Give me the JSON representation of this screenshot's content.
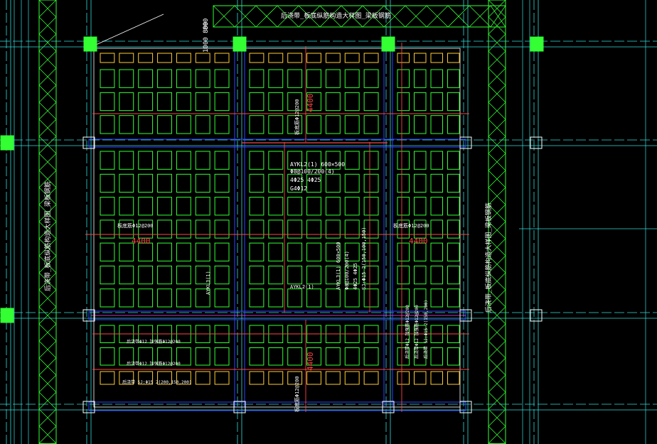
{
  "colors": {
    "background": "#000000",
    "green": "#33ff33",
    "yellow": "#ffcc33",
    "blue": "#3344ff",
    "red": "#ff4444",
    "cyan": "#33dddd",
    "white": "#ffffff",
    "magenta": "#ff44ff"
  },
  "labels": {
    "top_band": "后浇带_板底纵筋构造大样图_梁板钢筋",
    "dim_800_a": "800",
    "dim_800_b": "1000 800",
    "left_band": "后浇带_板底纵筋构造大样图_梁板钢筋",
    "right_band": "后浇带_板底纵筋构造大样图_梁板钢筋",
    "beam_note_1": "AYKL2(1) 600×500",
    "beam_note_2": "Φ8@100/200(4)",
    "beam_note_3": "4Φ25 4Φ25",
    "beam_note_4": "G4Φ12",
    "beam_note_5": "SJ:Φ15 2(150,100,150)",
    "dim_4400_top": "4400",
    "dim_4400_left": "4400",
    "dim_4400_right": "4400",
    "dim_4400_bottom": "4400",
    "slab_note_left": "板底筋Φ12@200",
    "slab_note_right": "板底筋Φ12@200",
    "slab_note_top": "板底筋Φ12@200",
    "slab_note_bottom": "板底筋Φ12@200",
    "beam_v_1": "AYKL3(1)",
    "beam_v_2": "AYKL3(1) 600×500",
    "beam_v_3": "Φ8@100/200(4)",
    "beam_v_4": "4Φ25 4Φ25",
    "beam_v_5": "SJ:Φ15 2(150,100,150)",
    "beam_mid": "AYKL2(1)",
    "note_b1": "后浇带Φ12 加强筋Φ12@200",
    "note_b2": "后浇带Φ12 加强筋Φ12@200",
    "note_b3": "后浇带 SJ:Φ15 2(200,150,200)",
    "note_r1": "后浇带Φ12 加强筋Φ12@200",
    "note_r2": "后浇带Φ12 加强筋Φ12@200",
    "note_r3": "后浇带 SJ:Φ15 2(150,200)"
  }
}
